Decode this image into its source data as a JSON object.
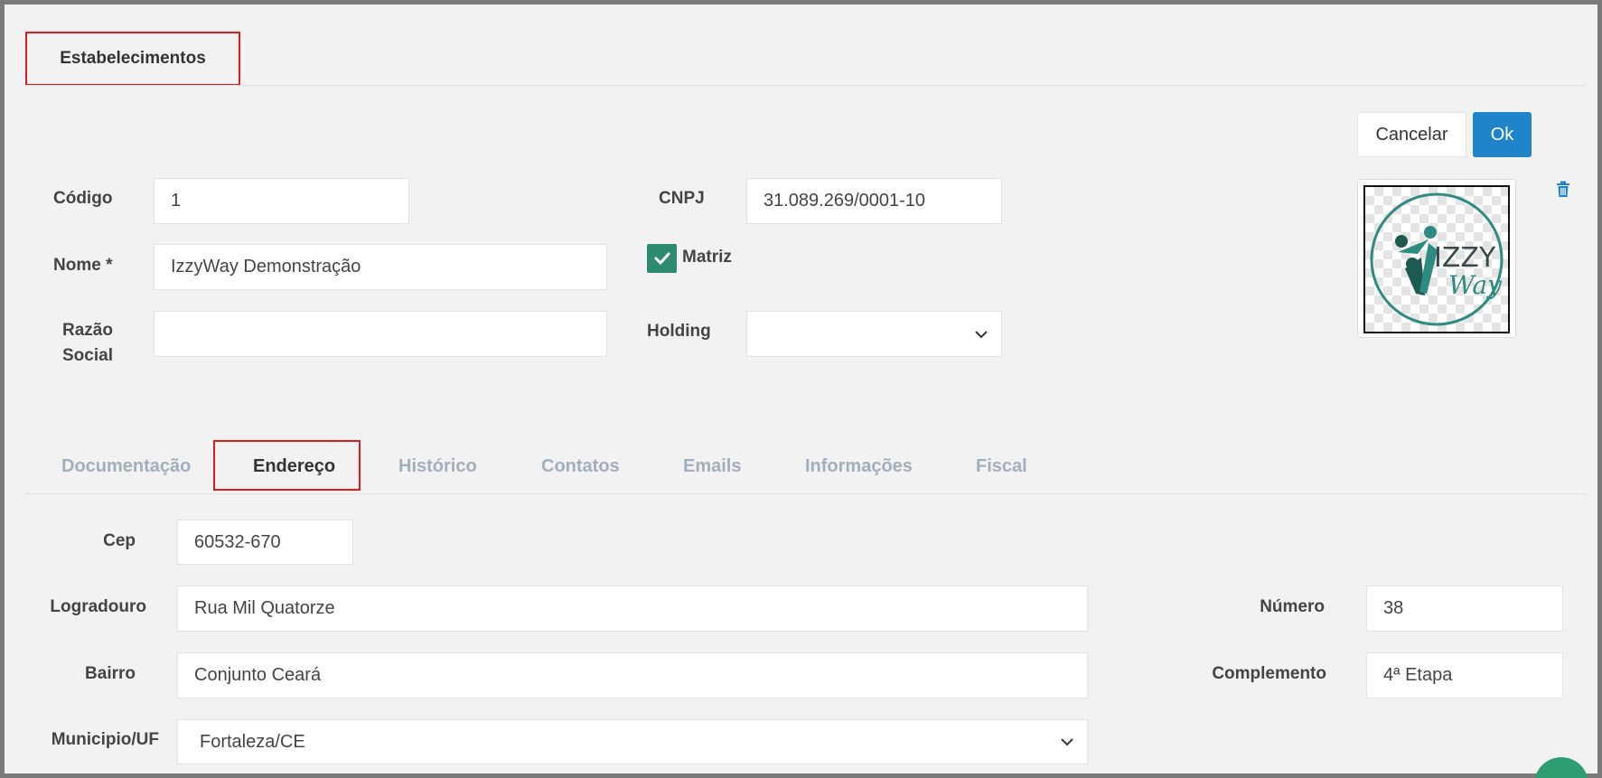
{
  "header": {
    "title": "Estabelecimentos"
  },
  "actions": {
    "cancel_label": "Cancelar",
    "ok_label": "Ok"
  },
  "form": {
    "codigo": {
      "label": "Código",
      "value": "1"
    },
    "nome": {
      "label": "Nome *",
      "value": "IzzyWay Demonstração"
    },
    "razao_social": {
      "label_line1": "Razão",
      "label_line2": "Social",
      "value": ""
    },
    "cnpj": {
      "label": "CNPJ",
      "value": "31.089.269/0001-10"
    },
    "matriz": {
      "label": "Matriz",
      "checked": true
    },
    "holding": {
      "label": "Holding",
      "value": ""
    }
  },
  "logo": {
    "text_top": "IZZY",
    "text_bottom": "Way"
  },
  "tabs": [
    {
      "label": "Documentação",
      "active": false
    },
    {
      "label": "Endereço",
      "active": true
    },
    {
      "label": "Histórico",
      "active": false
    },
    {
      "label": "Contatos",
      "active": false
    },
    {
      "label": "Emails",
      "active": false
    },
    {
      "label": "Informações",
      "active": false
    },
    {
      "label": "Fiscal",
      "active": false
    }
  ],
  "address": {
    "cep": {
      "label": "Cep",
      "value": "60532-670"
    },
    "logradouro": {
      "label": "Logradouro",
      "value": "Rua Mil Quatorze"
    },
    "numero": {
      "label": "Número",
      "value": "38"
    },
    "bairro": {
      "label": "Bairro",
      "value": "Conjunto Ceará"
    },
    "complemento": {
      "label": "Complemento",
      "value": "4ª Etapa"
    },
    "municipio": {
      "label": "Municipio/UF",
      "value": "Fortaleza/CE"
    }
  },
  "colors": {
    "accent_blue": "#1f84c9",
    "check_green": "#2e8b6f",
    "highlight_red": "#e01b1b",
    "tab_inactive": "#a3aebd"
  },
  "icons": {
    "delete": "trash-icon",
    "check": "check-icon",
    "dropdown": "chevron-down-icon"
  }
}
